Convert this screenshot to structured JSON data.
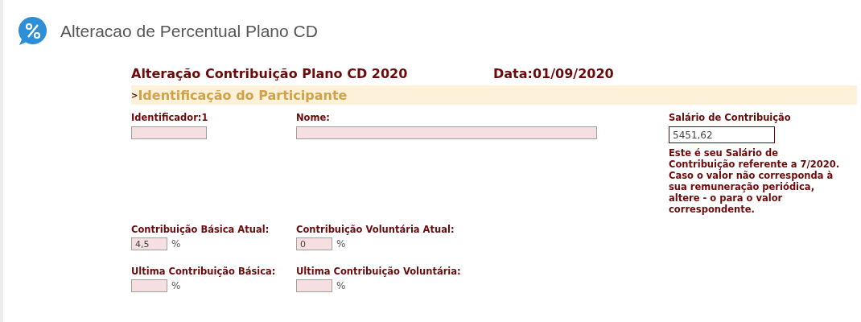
{
  "header": {
    "title": "Alteracao de Percentual Plano CD"
  },
  "form": {
    "title": "Alteração Contribuição Plano CD 2020",
    "date": "Data:01/09/2020",
    "section": {
      "marker": ">",
      "title": "Identificação do Participante"
    },
    "identification": [
      {
        "label": "Identificador:1",
        "kind": "short"
      },
      {
        "label": "Nome:",
        "kind": "long"
      }
    ],
    "salary": {
      "label": "Salário de Contribuição",
      "value": "5451,62",
      "note": "Este é seu Salário de Contribuição referente a 7/2020. Caso o valor não corresponda à sua remuneração periódica, altere - o para o valor correspondente."
    },
    "contributions": [
      {
        "label": "Contribuição Básica Atual:",
        "value": "4,5",
        "unit": "%"
      },
      {
        "label": "Contribuição Voluntária Atual:",
        "value": "0",
        "unit": "%"
      },
      {
        "label": "Ultima Contribuição Básica:",
        "unit": "%"
      },
      {
        "label": "Ultima Contribuição Voluntária:",
        "unit": "%"
      }
    ]
  }
}
